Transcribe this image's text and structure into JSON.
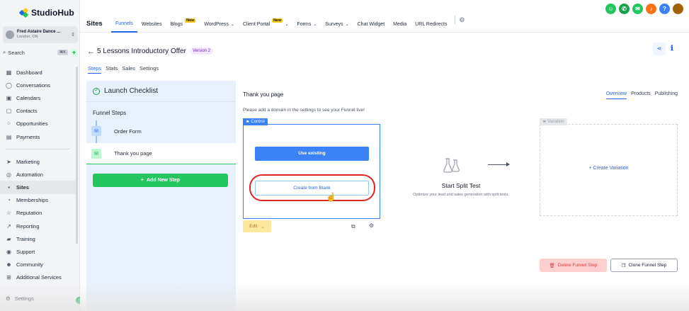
{
  "brand": {
    "name": "StudioHub"
  },
  "account": {
    "name": "Fred Astaire Dance ...",
    "location": "London, ON"
  },
  "search": {
    "label": "Search",
    "shortcut": "⌘K"
  },
  "sidebar": {
    "items": [
      {
        "label": "Dashboard",
        "icon": "grid-icon"
      },
      {
        "label": "Conversations",
        "icon": "chat-icon"
      },
      {
        "label": "Calendars",
        "icon": "calendar-icon"
      },
      {
        "label": "Contacts",
        "icon": "contacts-icon"
      },
      {
        "label": "Opportunities",
        "icon": "funnel-icon"
      },
      {
        "label": "Payments",
        "icon": "payments-icon"
      },
      {
        "label": "Marketing",
        "icon": "send-icon"
      },
      {
        "label": "Automation",
        "icon": "automation-icon"
      },
      {
        "label": "Sites",
        "icon": "sites-icon",
        "active": true
      },
      {
        "label": "Memberships",
        "icon": "membership-icon"
      },
      {
        "label": "Reputation",
        "icon": "star-icon"
      },
      {
        "label": "Reporting",
        "icon": "chart-icon"
      },
      {
        "label": "Training",
        "icon": "book-icon"
      },
      {
        "label": "Support",
        "icon": "support-icon"
      },
      {
        "label": "Community",
        "icon": "community-icon"
      },
      {
        "label": "Additional Services",
        "icon": "cart-icon"
      }
    ],
    "settings_label": "Settings"
  },
  "topnav": {
    "section_title": "Sites",
    "tabs": [
      {
        "label": "Funnels",
        "active": true
      },
      {
        "label": "Websites"
      },
      {
        "label": "Blogs",
        "badge": "New"
      },
      {
        "label": "WordPress",
        "caret": true
      },
      {
        "label": "Client Portal",
        "badge": "New",
        "caret": true
      },
      {
        "label": "Forms",
        "caret": true
      },
      {
        "label": "Surveys",
        "caret": true
      },
      {
        "label": "Chat Widget"
      },
      {
        "label": "Media"
      },
      {
        "label": "URL Redirects"
      }
    ]
  },
  "header_icon_colors": [
    "#22c55e",
    "#16a34a",
    "#22c55e",
    "#f97316",
    "#3b82f6"
  ],
  "page": {
    "title": "5 Lessons Introductory Offer",
    "version": "Version 2",
    "subtabs": [
      "Steps",
      "Stats",
      "Sales",
      "Settings"
    ]
  },
  "steps_panel": {
    "checklist_label": "Launch Checklist",
    "funnel_steps_label": "Funnel Steps",
    "steps": [
      "Order Form",
      "Thank you page"
    ],
    "add_step_label": "Add New Step"
  },
  "content": {
    "title": "Thank you page",
    "view_tabs": [
      "Overview",
      "Products",
      "Publishing"
    ],
    "domain_note": "Please add a domain in the settings to see your Funnel live!",
    "control_label": "Control",
    "use_existing": "Use existing",
    "create_blank": "Create from Blank",
    "edit_label": "Edit",
    "split_title": "Start Split Test",
    "split_sub": "Optimize your lead and sales generation with split tests.",
    "variation_label": "Variation",
    "create_variation": "Create Variation",
    "delete_label": "Delete Funnel Step",
    "clone_label": "Clone Funnel Step"
  }
}
